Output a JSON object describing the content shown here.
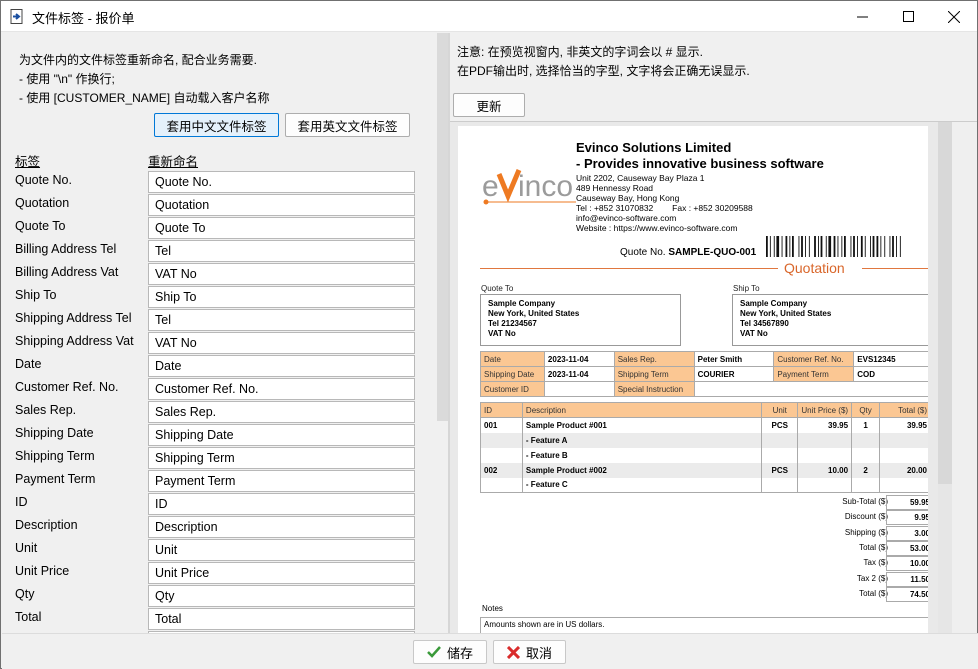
{
  "window": {
    "title": "文件标签 - 报价单",
    "controls": {
      "minimize": "—",
      "maximize": "☐",
      "close": "✕"
    }
  },
  "left": {
    "intro": [
      "为文件内的文件标签重新命名, 配合业务需要.",
      "- 使用 \"\\n\" 作换行;",
      "- 使用 [CUSTOMER_NAME] 自动载入客户名称"
    ],
    "btn_chinese": "套用中文文件标签",
    "btn_english": "套用英文文件标签",
    "col_label": "标签",
    "col_rename": "重新命名",
    "rows": [
      {
        "label": "Quote No.",
        "value": "Quote No."
      },
      {
        "label": "Quotation",
        "value": "Quotation"
      },
      {
        "label": "Quote To",
        "value": "Quote To"
      },
      {
        "label": "Billing Address Tel",
        "value": "Tel"
      },
      {
        "label": "Billing Address Vat",
        "value": "VAT No"
      },
      {
        "label": "Ship To",
        "value": "Ship To"
      },
      {
        "label": "Shipping Address Tel",
        "value": "Tel"
      },
      {
        "label": "Shipping Address Vat",
        "value": "VAT No"
      },
      {
        "label": "Date",
        "value": "Date"
      },
      {
        "label": "Customer Ref. No.",
        "value": "Customer Ref. No."
      },
      {
        "label": "Sales Rep.",
        "value": "Sales Rep."
      },
      {
        "label": "Shipping Date",
        "value": "Shipping Date"
      },
      {
        "label": "Shipping Term",
        "value": "Shipping Term"
      },
      {
        "label": "Payment Term",
        "value": "Payment Term"
      },
      {
        "label": "ID",
        "value": "ID"
      },
      {
        "label": "Description",
        "value": "Description"
      },
      {
        "label": "Unit",
        "value": "Unit"
      },
      {
        "label": "Unit Price",
        "value": "Unit Price"
      },
      {
        "label": "Qty",
        "value": "Qty"
      },
      {
        "label": "Total",
        "value": "Total"
      },
      {
        "label": "",
        "value": ""
      }
    ]
  },
  "right": {
    "note": [
      "注意: 在预览视窗内, 非英文的字词会以 # 显示.",
      "在PDF输出时, 选择恰当的字型, 文字将会正确无误显示."
    ],
    "refresh": "更新"
  },
  "doc": {
    "logo_text": "eVinco",
    "company": "Evinco Solutions Limited",
    "tagline": "- Provides innovative business software",
    "address": [
      "Unit 2202, Causeway Bay Plaza 1",
      "489 Hennessy Road",
      "Causeway Bay, Hong Kong",
      "Tel : +852 31070832        Fax : +852 30209588",
      "info@evinco-software.com",
      "Website : https://www.evinco-software.com"
    ],
    "quote_no_label": "Quote No.",
    "quote_no": "SAMPLE-QUO-001",
    "title": "Quotation",
    "quote_to_label": "Quote To",
    "quote_to": [
      "Sample Company",
      "New York, United States",
      "Tel 21234567",
      "VAT No"
    ],
    "ship_to_label": "Ship To",
    "ship_to": [
      "Sample Company",
      "New York, United States",
      "Tel 34567890",
      "VAT No"
    ],
    "info": [
      [
        "Date",
        "2023-11-04",
        "Sales Rep.",
        "Peter Smith",
        "Customer Ref. No.",
        "EVS12345"
      ],
      [
        "Shipping Date",
        "2023-11-04",
        "Shipping Term",
        "COURIER",
        "Payment Term",
        "COD"
      ],
      [
        "Customer ID",
        "",
        "Special Instruction",
        "",
        "",
        ""
      ]
    ],
    "item_headers": [
      "ID",
      "Description",
      "Unit",
      "Unit Price ($)",
      "Qty",
      "Total ($)"
    ],
    "items": [
      [
        "001",
        "Sample Product #001",
        "PCS",
        "39.95",
        "1",
        "39.95"
      ],
      [
        "",
        "- Feature A",
        "",
        "",
        "",
        ""
      ],
      [
        "",
        "- Feature B",
        "",
        "",
        "",
        ""
      ],
      [
        "002",
        "Sample Product #002",
        "PCS",
        "10.00",
        "2",
        "20.00"
      ],
      [
        "",
        "- Feature C",
        "",
        "",
        "",
        ""
      ]
    ],
    "totals": [
      {
        "label": "Sub-Total ($)",
        "value": "59.95"
      },
      {
        "label": "Discount ($)",
        "value": "9.95"
      },
      {
        "label": "Shipping ($)",
        "value": "3.00"
      },
      {
        "label": "Total ($)",
        "value": "53.00"
      },
      {
        "label": "Tax ($)",
        "value": "10.00"
      },
      {
        "label": "Tax 2 ($)",
        "value": "11.50"
      },
      {
        "label": "Total ($)",
        "value": "74.50"
      }
    ],
    "notes_label": "Notes",
    "notes": "Amounts shown are in US dollars."
  },
  "footer": {
    "save": "储存",
    "cancel": "取消"
  },
  "colors": {
    "accent_orange": "#e0773f",
    "header_fill": "#fbc793",
    "save_check": "#3a9a3a",
    "cancel_x": "#d92b2b"
  }
}
